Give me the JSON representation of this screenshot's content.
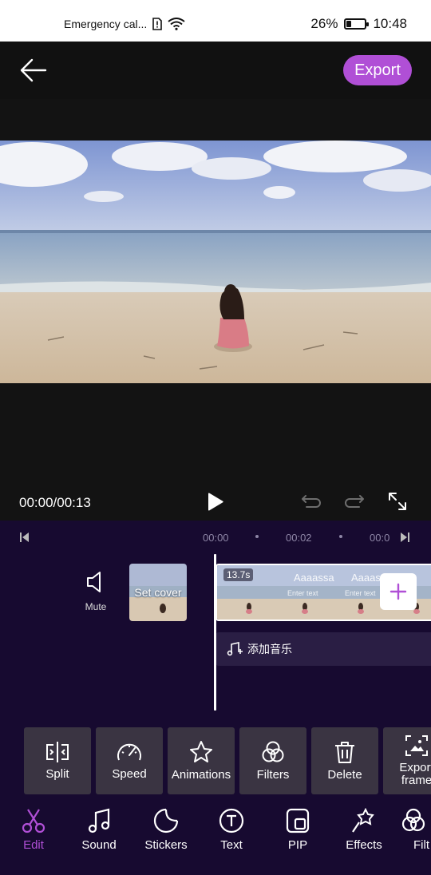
{
  "status_bar": {
    "carrier": "Emergency cal...",
    "battery": "26%",
    "battery_level": 0.26,
    "time": "10:48"
  },
  "top_bar": {
    "export_label": "Export"
  },
  "player": {
    "time_display": "00:00/00:13"
  },
  "timeline": {
    "ticks": [
      "00:00",
      "00:02",
      "00:0"
    ],
    "mute_label": "Mute",
    "cover_label": "Set cover",
    "clip_duration": "13.7s",
    "clip_overlay_title": "Aaaassa",
    "clip_overlay_sub": "Enter text",
    "music_label": "添加音乐"
  },
  "tools": [
    {
      "label": "Split",
      "icon": "split-icon"
    },
    {
      "label": "Speed",
      "icon": "speed-icon"
    },
    {
      "label": "Animations",
      "icon": "animations-icon"
    },
    {
      "label": "Filters",
      "icon": "filters-icon"
    },
    {
      "label": "Delete",
      "icon": "delete-icon"
    },
    {
      "label": "Export frame",
      "icon": "export-frame-icon"
    }
  ],
  "tabs": [
    {
      "label": "Edit",
      "icon": "scissors-icon",
      "active": true
    },
    {
      "label": "Sound",
      "icon": "music-icon"
    },
    {
      "label": "Stickers",
      "icon": "sticker-icon"
    },
    {
      "label": "Text",
      "icon": "text-icon"
    },
    {
      "label": "PIP",
      "icon": "pip-icon"
    },
    {
      "label": "Effects",
      "icon": "effects-icon"
    },
    {
      "label": "Filt",
      "icon": "filters-icon"
    }
  ],
  "colors": {
    "accent": "#b04fd6",
    "editor_bg": "#170a30",
    "tool_bg": "#3a3442"
  }
}
